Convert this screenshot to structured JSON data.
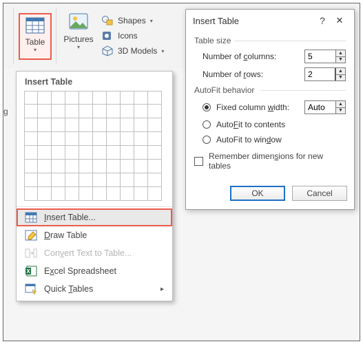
{
  "ribbon": {
    "table_label": "Table",
    "pictures_label": "Pictures",
    "shapes_label": "Shapes",
    "icons_label": "Icons",
    "models_label": "3D Models"
  },
  "dropdown": {
    "title": "Insert Table",
    "grid_cols": 10,
    "grid_rows": 8,
    "items": {
      "insert_table": "Insert Table...",
      "draw_table": "Draw Table",
      "convert_text": "Convert Text to Table...",
      "excel": "Excel Spreadsheet",
      "quick_tables": "Quick Tables"
    }
  },
  "dialog": {
    "title": "Insert Table",
    "group_size": "Table size",
    "num_cols_label": "Number of columns:",
    "num_cols_value": "5",
    "num_rows_label": "Number of rows:",
    "num_rows_value": "2",
    "group_autofit": "AutoFit behavior",
    "fixed_label": "Fixed column width:",
    "fixed_value": "Auto",
    "fit_contents": "AutoFit to contents",
    "fit_window": "AutoFit to window",
    "remember": "Remember dimensions for new tables",
    "ok": "OK",
    "cancel": "Cancel"
  },
  "partial": "g"
}
